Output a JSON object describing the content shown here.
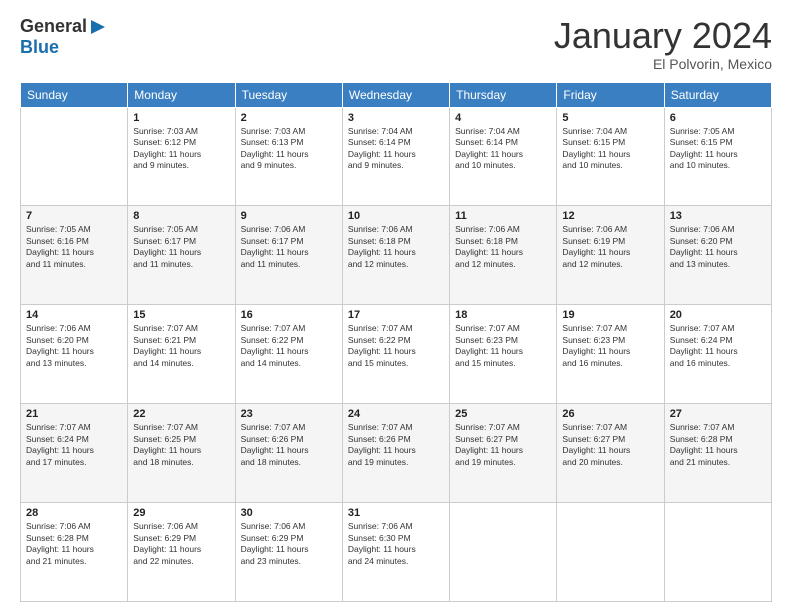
{
  "header": {
    "logo_general": "General",
    "logo_blue": "Blue",
    "month_title": "January 2024",
    "location": "El Polvorin, Mexico"
  },
  "days_of_week": [
    "Sunday",
    "Monday",
    "Tuesday",
    "Wednesday",
    "Thursday",
    "Friday",
    "Saturday"
  ],
  "weeks": [
    [
      {
        "day": "",
        "info": ""
      },
      {
        "day": "1",
        "info": "Sunrise: 7:03 AM\nSunset: 6:12 PM\nDaylight: 11 hours\nand 9 minutes."
      },
      {
        "day": "2",
        "info": "Sunrise: 7:03 AM\nSunset: 6:13 PM\nDaylight: 11 hours\nand 9 minutes."
      },
      {
        "day": "3",
        "info": "Sunrise: 7:04 AM\nSunset: 6:14 PM\nDaylight: 11 hours\nand 9 minutes."
      },
      {
        "day": "4",
        "info": "Sunrise: 7:04 AM\nSunset: 6:14 PM\nDaylight: 11 hours\nand 10 minutes."
      },
      {
        "day": "5",
        "info": "Sunrise: 7:04 AM\nSunset: 6:15 PM\nDaylight: 11 hours\nand 10 minutes."
      },
      {
        "day": "6",
        "info": "Sunrise: 7:05 AM\nSunset: 6:15 PM\nDaylight: 11 hours\nand 10 minutes."
      }
    ],
    [
      {
        "day": "7",
        "info": "Sunrise: 7:05 AM\nSunset: 6:16 PM\nDaylight: 11 hours\nand 11 minutes."
      },
      {
        "day": "8",
        "info": "Sunrise: 7:05 AM\nSunset: 6:17 PM\nDaylight: 11 hours\nand 11 minutes."
      },
      {
        "day": "9",
        "info": "Sunrise: 7:06 AM\nSunset: 6:17 PM\nDaylight: 11 hours\nand 11 minutes."
      },
      {
        "day": "10",
        "info": "Sunrise: 7:06 AM\nSunset: 6:18 PM\nDaylight: 11 hours\nand 12 minutes."
      },
      {
        "day": "11",
        "info": "Sunrise: 7:06 AM\nSunset: 6:18 PM\nDaylight: 11 hours\nand 12 minutes."
      },
      {
        "day": "12",
        "info": "Sunrise: 7:06 AM\nSunset: 6:19 PM\nDaylight: 11 hours\nand 12 minutes."
      },
      {
        "day": "13",
        "info": "Sunrise: 7:06 AM\nSunset: 6:20 PM\nDaylight: 11 hours\nand 13 minutes."
      }
    ],
    [
      {
        "day": "14",
        "info": "Sunrise: 7:06 AM\nSunset: 6:20 PM\nDaylight: 11 hours\nand 13 minutes."
      },
      {
        "day": "15",
        "info": "Sunrise: 7:07 AM\nSunset: 6:21 PM\nDaylight: 11 hours\nand 14 minutes."
      },
      {
        "day": "16",
        "info": "Sunrise: 7:07 AM\nSunset: 6:22 PM\nDaylight: 11 hours\nand 14 minutes."
      },
      {
        "day": "17",
        "info": "Sunrise: 7:07 AM\nSunset: 6:22 PM\nDaylight: 11 hours\nand 15 minutes."
      },
      {
        "day": "18",
        "info": "Sunrise: 7:07 AM\nSunset: 6:23 PM\nDaylight: 11 hours\nand 15 minutes."
      },
      {
        "day": "19",
        "info": "Sunrise: 7:07 AM\nSunset: 6:23 PM\nDaylight: 11 hours\nand 16 minutes."
      },
      {
        "day": "20",
        "info": "Sunrise: 7:07 AM\nSunset: 6:24 PM\nDaylight: 11 hours\nand 16 minutes."
      }
    ],
    [
      {
        "day": "21",
        "info": "Sunrise: 7:07 AM\nSunset: 6:24 PM\nDaylight: 11 hours\nand 17 minutes."
      },
      {
        "day": "22",
        "info": "Sunrise: 7:07 AM\nSunset: 6:25 PM\nDaylight: 11 hours\nand 18 minutes."
      },
      {
        "day": "23",
        "info": "Sunrise: 7:07 AM\nSunset: 6:26 PM\nDaylight: 11 hours\nand 18 minutes."
      },
      {
        "day": "24",
        "info": "Sunrise: 7:07 AM\nSunset: 6:26 PM\nDaylight: 11 hours\nand 19 minutes."
      },
      {
        "day": "25",
        "info": "Sunrise: 7:07 AM\nSunset: 6:27 PM\nDaylight: 11 hours\nand 19 minutes."
      },
      {
        "day": "26",
        "info": "Sunrise: 7:07 AM\nSunset: 6:27 PM\nDaylight: 11 hours\nand 20 minutes."
      },
      {
        "day": "27",
        "info": "Sunrise: 7:07 AM\nSunset: 6:28 PM\nDaylight: 11 hours\nand 21 minutes."
      }
    ],
    [
      {
        "day": "28",
        "info": "Sunrise: 7:06 AM\nSunset: 6:28 PM\nDaylight: 11 hours\nand 21 minutes."
      },
      {
        "day": "29",
        "info": "Sunrise: 7:06 AM\nSunset: 6:29 PM\nDaylight: 11 hours\nand 22 minutes."
      },
      {
        "day": "30",
        "info": "Sunrise: 7:06 AM\nSunset: 6:29 PM\nDaylight: 11 hours\nand 23 minutes."
      },
      {
        "day": "31",
        "info": "Sunrise: 7:06 AM\nSunset: 6:30 PM\nDaylight: 11 hours\nand 24 minutes."
      },
      {
        "day": "",
        "info": ""
      },
      {
        "day": "",
        "info": ""
      },
      {
        "day": "",
        "info": ""
      }
    ]
  ]
}
